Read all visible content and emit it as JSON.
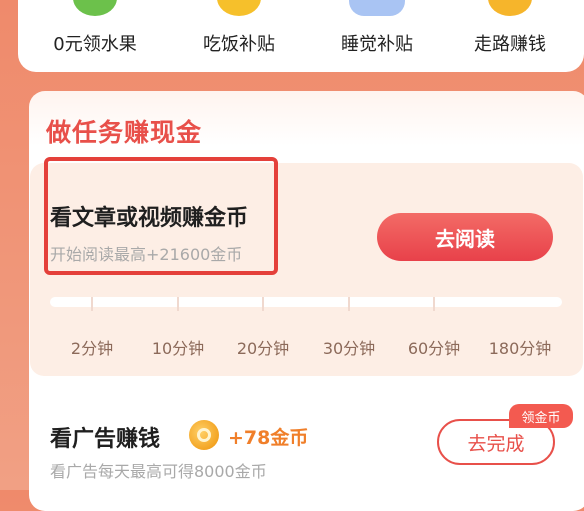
{
  "shortcuts": [
    {
      "label": "0元领水果",
      "icon": "tree-icon",
      "color": "#6cc14b"
    },
    {
      "label": "吃饭补贴",
      "icon": "yuan-coin-icon",
      "color": "#f6c02b"
    },
    {
      "label": "睡觉补贴",
      "icon": "moon-cloud-icon",
      "color": "#a9c4f3"
    },
    {
      "label": "走路赚钱",
      "icon": "coin-icon",
      "color": "#f6b52b"
    }
  ],
  "task_section": {
    "title": "做任务赚现金",
    "read_task": {
      "title": "看文章或视频赚金币",
      "subtitle": "开始阅读最高+21600金币",
      "button": "去阅读",
      "progress_fraction": 0,
      "milestones": [
        "2分钟",
        "10分钟",
        "20分钟",
        "30分钟",
        "60分钟",
        "180分钟"
      ]
    },
    "ad_task": {
      "title": "看广告赚钱",
      "reward": "+78金币",
      "subtitle": "看广告每天最高可得8000金币",
      "button": "去完成",
      "badge": "领金币"
    }
  },
  "colors": {
    "accent_red": "#e8504a",
    "reward_orange": "#f07f2a",
    "page_bg": "#ef8a6b"
  }
}
